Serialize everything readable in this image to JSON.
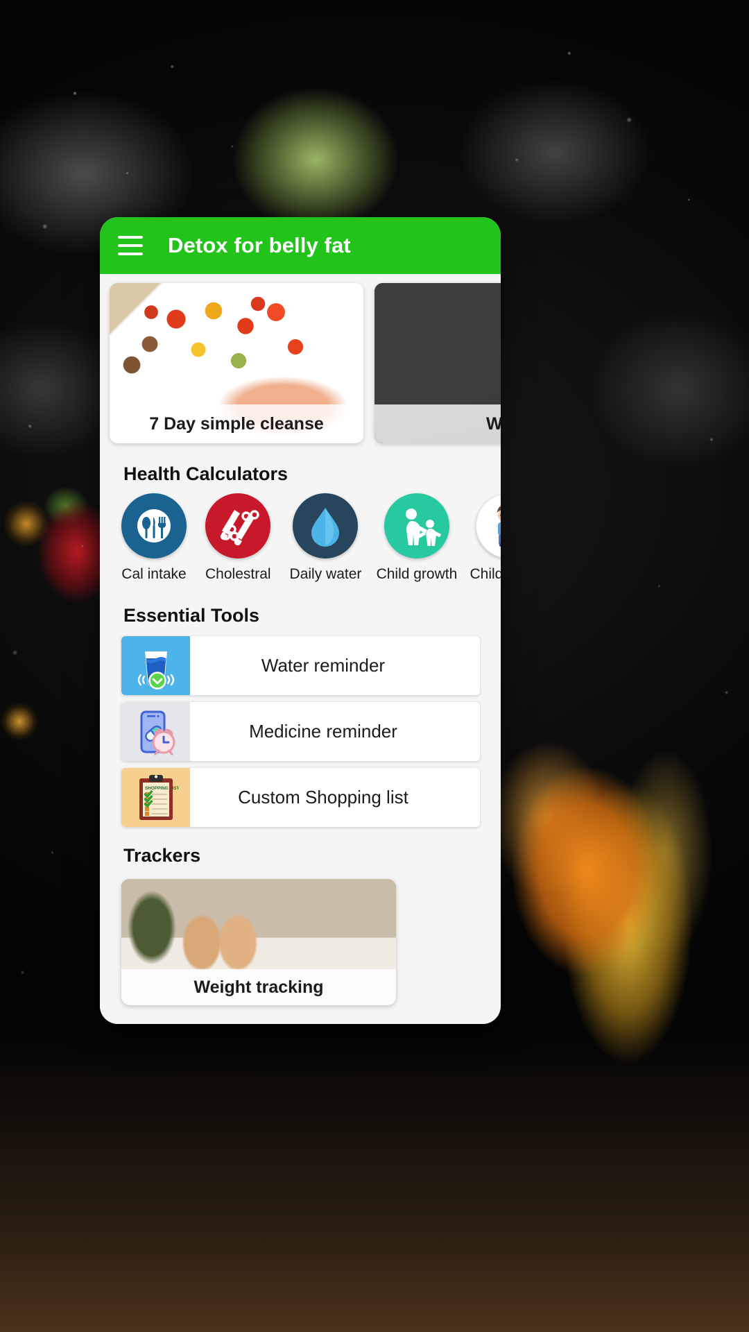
{
  "theme": {
    "accent": "#22c41c",
    "app_background": "#f5f5f5",
    "text_dark": "#1b1b1b"
  },
  "appbar": {
    "menu_icon": "hamburger-menu-icon",
    "title": "Detox for belly fat"
  },
  "carousel": {
    "cards": [
      {
        "title": "7 Day simple cleanse",
        "image": "roasted-vegetables-salmon-photo"
      },
      {
        "title": "Wei",
        "image": "dark-slate-board-photo"
      }
    ]
  },
  "health_calculators": {
    "heading": "Health Calculators",
    "items": [
      {
        "label": "Cal intake",
        "icon": "plate-cutlery-icon",
        "color": "#1a6390"
      },
      {
        "label": "Cholestral",
        "icon": "blood-vials-icon",
        "color": "#c8192b"
      },
      {
        "label": "Daily water",
        "icon": "water-drop-icon",
        "color": "#27455c"
      },
      {
        "label": "Child growth",
        "icon": "parent-child-icon",
        "color": "#27c9a0"
      },
      {
        "label": "Child height",
        "icon": "child-ruler-icon",
        "color": "#ffffff"
      }
    ]
  },
  "essential_tools": {
    "heading": "Essential Tools",
    "items": [
      {
        "label": "Water reminder",
        "icon": "water-glass-clock-icon",
        "tile_color": "#4db4ea"
      },
      {
        "label": "Medicine reminder",
        "icon": "phone-pill-alarm-icon",
        "tile_color": "#e4e6ea"
      },
      {
        "label": "Custom Shopping list",
        "icon": "shopping-list-clipboard-icon",
        "tile_color": "#f7cf8e"
      }
    ]
  },
  "trackers": {
    "heading": "Trackers",
    "items": [
      {
        "label": "Weight tracking",
        "image": "feet-on-bathroom-scale-photo"
      }
    ]
  }
}
